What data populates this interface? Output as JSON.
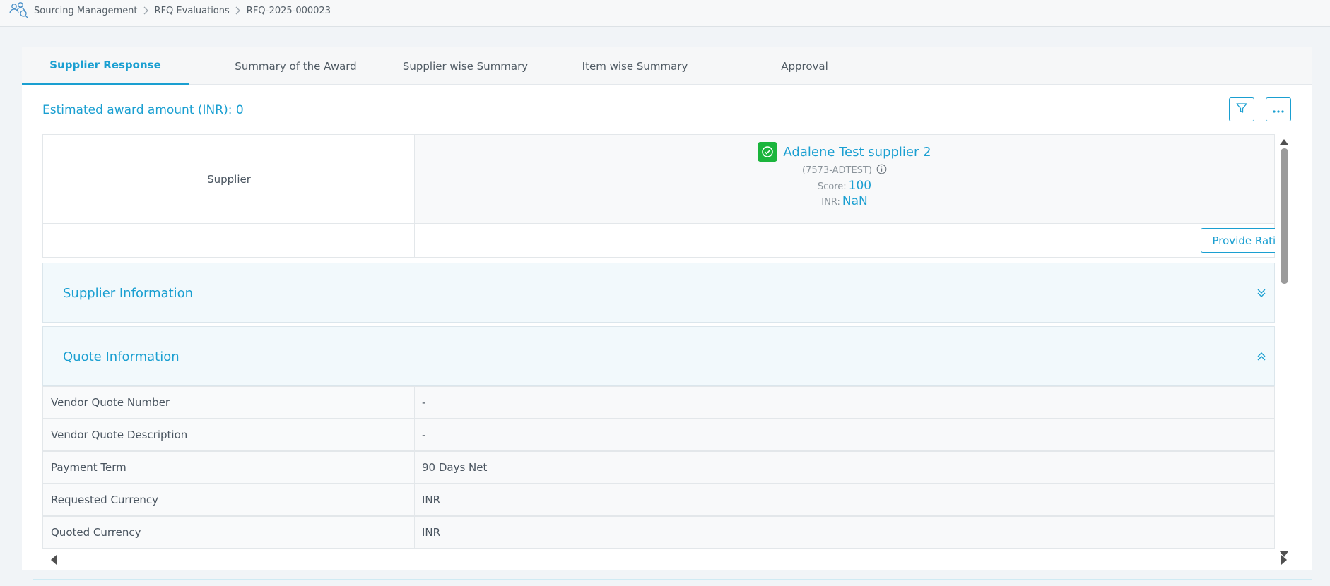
{
  "breadcrumb": {
    "icon": "sourcing-people-icon",
    "items": [
      "Sourcing Management",
      "RFQ Evaluations",
      "RFQ-2025-000023"
    ]
  },
  "tabs": [
    {
      "label": "Supplier Response",
      "active": true
    },
    {
      "label": "Summary of the Award",
      "active": false
    },
    {
      "label": "Supplier wise Summary",
      "active": false
    },
    {
      "label": "Item wise Summary",
      "active": false
    },
    {
      "label": "Approval",
      "active": false
    }
  ],
  "award": {
    "text": "Estimated award amount (INR): 0"
  },
  "toolbar": {
    "filter_icon": "filter-icon",
    "more_icon": "more-horizontal-icon"
  },
  "supplier_table": {
    "header_label": "Supplier",
    "supplier": {
      "name": "Adalene Test supplier 2",
      "code": "(7573-ADTEST)",
      "score_label": "Score:",
      "score_value": "100",
      "currency_label": "INR:",
      "currency_value": "NaN",
      "status_icon": "check-circle-icon"
    },
    "rationale_button": "Provide Rationale"
  },
  "sections": {
    "supplier_info": {
      "title": "Supplier Information",
      "expanded": false
    },
    "quote_info": {
      "title": "Quote Information",
      "expanded": true
    }
  },
  "quote_rows": [
    {
      "label": "Vendor Quote Number",
      "value": "-"
    },
    {
      "label": "Vendor Quote Description",
      "value": "-"
    },
    {
      "label": "Payment Term",
      "value": "90 Days Net"
    },
    {
      "label": "Requested Currency",
      "value": "INR"
    },
    {
      "label": "Quoted Currency",
      "value": "INR"
    }
  ],
  "colors": {
    "accent": "#1a9fd1",
    "success": "#1bb53c",
    "text": "#4a5560"
  }
}
